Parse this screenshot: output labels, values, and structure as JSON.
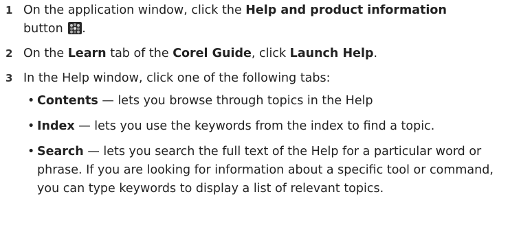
{
  "steps": [
    {
      "number": "1",
      "t1": "On the application window, click the ",
      "b1": "Help and product information",
      "t2": " button ",
      "icon": "help-and-product-information-icon",
      "t3": "."
    },
    {
      "number": "2",
      "t1": "On the ",
      "b1": "Learn",
      "t2": " tab of the ",
      "b2": "Corel Guide",
      "t3": ", click ",
      "b3": "Launch Help",
      "t4": "."
    },
    {
      "number": "3",
      "t1": "In the Help window, click one of the following tabs:",
      "tabs": [
        {
          "bullet": "•",
          "name": "Contents",
          "desc": " — lets you browse through topics in the Help"
        },
        {
          "bullet": "•",
          "name": "Index",
          "desc": " — lets you use the keywords from the index to find a topic."
        },
        {
          "bullet": "•",
          "name": "Search",
          "desc": " — lets you search the full text of the Help for a particular word or phrase. If you are looking for information about a specific tool or command, you can type keywords to display a list of relevant topics."
        }
      ]
    }
  ]
}
